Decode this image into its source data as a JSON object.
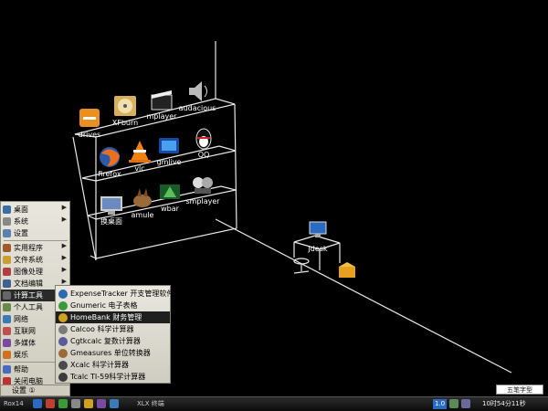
{
  "desktop": {
    "shelf_icons": [
      {
        "label": "drives",
        "icon": "drive-icon"
      },
      {
        "label": "XFburn",
        "icon": "disc-burner-icon"
      },
      {
        "label": "mplayer",
        "icon": "film-clapper-icon"
      },
      {
        "label": "audacious",
        "icon": "speaker-icon"
      },
      {
        "label": "firefox",
        "icon": "firefox-icon"
      },
      {
        "label": "vlc",
        "icon": "vlc-cone-icon"
      },
      {
        "label": "gmlive",
        "icon": "tv-clapper-icon"
      },
      {
        "label": "QQ",
        "icon": "penguin-icon"
      },
      {
        "label": "换桌面",
        "icon": "desktop-switch-icon"
      },
      {
        "label": "amule",
        "icon": "mule-icon"
      },
      {
        "label": "wbar",
        "icon": "wbar-icon"
      },
      {
        "label": "smplayer",
        "icon": "smplayer-icon"
      }
    ],
    "desk_item": {
      "label": "Jdesk",
      "icon": "computer-icon"
    }
  },
  "start_menu": {
    "items": [
      {
        "label": "桌面",
        "has_submenu": true,
        "color": "#3a6ea5"
      },
      {
        "label": "系统",
        "has_submenu": true,
        "color": "#888888"
      },
      {
        "label": "设置",
        "has_submenu": false,
        "color": "#5a7fb0"
      },
      {
        "label": "实用程序",
        "has_submenu": true,
        "color": "#a05a2a"
      },
      {
        "label": "文件系统",
        "has_submenu": true,
        "color": "#c8a030"
      },
      {
        "label": "图像处理",
        "has_submenu": true,
        "color": "#b04040"
      },
      {
        "label": "文档编辑",
        "has_submenu": true,
        "color": "#406090"
      },
      {
        "label": "计算工具",
        "has_submenu": true,
        "color": "#404040",
        "active": true
      },
      {
        "label": "个人工具",
        "has_submenu": true,
        "color": "#6a8a4a"
      },
      {
        "label": "网络",
        "has_submenu": true,
        "color": "#3a7ab8"
      },
      {
        "label": "互联网",
        "has_submenu": true,
        "color": "#c05050"
      },
      {
        "label": "多媒体",
        "has_submenu": true,
        "color": "#7a4aa0"
      },
      {
        "label": "娱乐",
        "has_submenu": true,
        "color": "#d07020"
      },
      {
        "label": "帮助",
        "has_submenu": false,
        "color": "#4a6ac0"
      },
      {
        "label": "关闭电脑",
        "has_submenu": false,
        "color": "#c03030"
      }
    ],
    "bottom_label": "设置 ①"
  },
  "submenu": {
    "items": [
      {
        "label": "ExpenseTracker 开支管理软件",
        "color": "#2a6ab0"
      },
      {
        "label": "Gnumeric 电子表格",
        "color": "#3a9a3a"
      },
      {
        "label": "HomeBank 财务管理",
        "color": "#d0a020",
        "active": true
      },
      {
        "label": "Calcoo 科学计算器",
        "color": "#7a7a7a"
      },
      {
        "label": "Cgtkcalc 复数计算器",
        "color": "#5a5a9a"
      },
      {
        "label": "Gmeasures 单位转换器",
        "color": "#9a6a3a"
      },
      {
        "label": "Xcalc 科学计算器",
        "color": "#4a4a4a"
      },
      {
        "label": "Tcalc TI-59科学计算器",
        "color": "#3a3a3a"
      }
    ]
  },
  "taskbar": {
    "start_label": "Rox14",
    "window_label": "XLX 终端",
    "volume": "1.0",
    "clock": "10时54分11秒",
    "notification": "五笔字型"
  }
}
